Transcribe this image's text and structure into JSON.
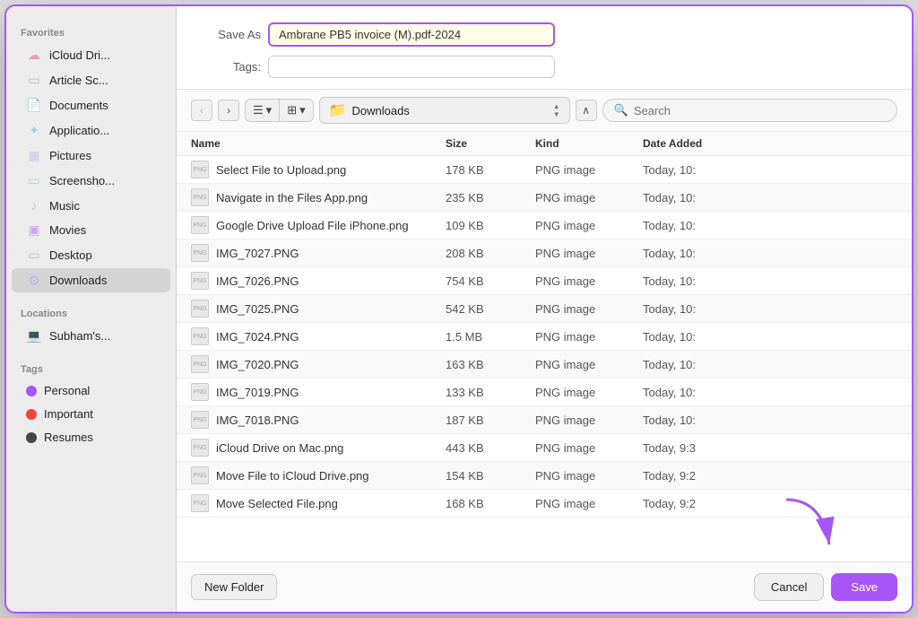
{
  "dialog": {
    "title": "Save As",
    "save_as_value": "Ambrane PB5 invoice (M).pdf-2024",
    "tags_placeholder": "",
    "search_placeholder": "Search"
  },
  "sidebar": {
    "favorites_label": "Favorites",
    "locations_label": "Locations",
    "tags_label": "Tags",
    "favorites": [
      {
        "id": "icloud",
        "label": "iCloud Dri...",
        "icon": "☁"
      },
      {
        "id": "article",
        "label": "Article Sc...",
        "icon": "▭"
      },
      {
        "id": "documents",
        "label": "Documents",
        "icon": "📄"
      },
      {
        "id": "applications",
        "label": "Applicatio...",
        "icon": "✦"
      },
      {
        "id": "pictures",
        "label": "Pictures",
        "icon": "▦"
      },
      {
        "id": "screenshots",
        "label": "Screensho...",
        "icon": "▭"
      },
      {
        "id": "music",
        "label": "Music",
        "icon": "♪"
      },
      {
        "id": "movies",
        "label": "Movies",
        "icon": "▣"
      },
      {
        "id": "desktop",
        "label": "Desktop",
        "icon": "▭"
      },
      {
        "id": "downloads",
        "label": "Downloads",
        "icon": "⊙",
        "active": true
      }
    ],
    "locations": [
      {
        "id": "subhams",
        "label": "Subham's...",
        "icon": "💻"
      }
    ],
    "tags": [
      {
        "id": "personal",
        "label": "Personal",
        "color": "#a855f7"
      },
      {
        "id": "important",
        "label": "Important",
        "color": "#ef4444"
      },
      {
        "id": "resumes",
        "label": "Resumes",
        "color": "#444"
      }
    ]
  },
  "toolbar": {
    "back_label": "‹",
    "forward_label": "›",
    "list_icon": "☰",
    "grid_icon": "⊞",
    "current_folder": "Downloads",
    "expand_icon": "∧"
  },
  "file_list": {
    "columns": [
      "Name",
      "Size",
      "Kind",
      "Date Added"
    ],
    "files": [
      {
        "name": "Select File to Upload.png",
        "size": "178 KB",
        "kind": "PNG image",
        "date": "Today, 10:"
      },
      {
        "name": "Navigate in the Files App.png",
        "size": "235 KB",
        "kind": "PNG image",
        "date": "Today, 10:"
      },
      {
        "name": "Google Drive Upload File iPhone.png",
        "size": "109 KB",
        "kind": "PNG image",
        "date": "Today, 10:"
      },
      {
        "name": "IMG_7027.PNG",
        "size": "208 KB",
        "kind": "PNG image",
        "date": "Today, 10:"
      },
      {
        "name": "IMG_7026.PNG",
        "size": "754 KB",
        "kind": "PNG image",
        "date": "Today, 10:"
      },
      {
        "name": "IMG_7025.PNG",
        "size": "542 KB",
        "kind": "PNG image",
        "date": "Today, 10:"
      },
      {
        "name": "IMG_7024.PNG",
        "size": "1.5 MB",
        "kind": "PNG image",
        "date": "Today, 10:"
      },
      {
        "name": "IMG_7020.PNG",
        "size": "163 KB",
        "kind": "PNG image",
        "date": "Today, 10:"
      },
      {
        "name": "IMG_7019.PNG",
        "size": "133 KB",
        "kind": "PNG image",
        "date": "Today, 10:"
      },
      {
        "name": "IMG_7018.PNG",
        "size": "187 KB",
        "kind": "PNG image",
        "date": "Today, 10:"
      },
      {
        "name": "iCloud Drive on Mac.png",
        "size": "443 KB",
        "kind": "PNG image",
        "date": "Today, 9:3"
      },
      {
        "name": "Move File to iCloud Drive.png",
        "size": "154 KB",
        "kind": "PNG image",
        "date": "Today, 9:2"
      },
      {
        "name": "Move Selected File.png",
        "size": "168 KB",
        "kind": "PNG image",
        "date": "Today, 9:2"
      }
    ]
  },
  "bottom": {
    "new_folder_label": "New Folder",
    "cancel_label": "Cancel",
    "save_label": "Save"
  }
}
